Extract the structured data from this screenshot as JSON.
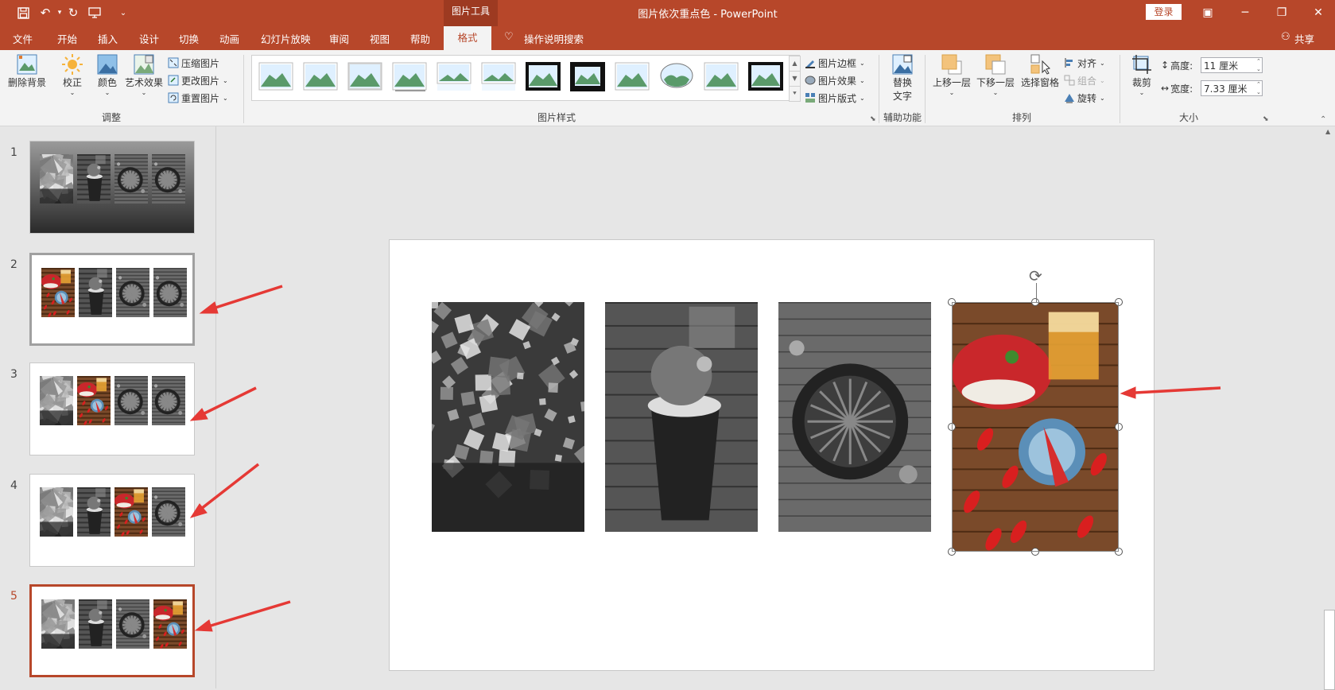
{
  "titlebar": {
    "doc_title": "图片依次重点色 - PowerPoint",
    "context_tools": "图片工具",
    "login": "登录",
    "share": "共享"
  },
  "tabs": [
    "文件",
    "开始",
    "插入",
    "设计",
    "切换",
    "动画",
    "幻灯片放映",
    "审阅",
    "视图",
    "帮助",
    "格式"
  ],
  "active_tab": "格式",
  "tell_me": "操作说明搜索",
  "ribbon": {
    "adjust": {
      "remove_bg": "删除背景",
      "correct": "校正",
      "color": "颜色",
      "artistic": "艺术效果",
      "compress": "压缩图片",
      "change": "更改图片",
      "reset": "重置图片",
      "label": "调整"
    },
    "styles": {
      "label": "图片样式",
      "border": "图片边框",
      "effects": "图片效果",
      "layout": "图片版式"
    },
    "accessibility": {
      "alt_text_line1": "替换",
      "alt_text_line2": "文字",
      "label": "辅助功能"
    },
    "arrange": {
      "bring_forward": "上移一层",
      "send_backward": "下移一层",
      "selection_pane": "选择窗格",
      "align": "对齐",
      "group": "组合",
      "rotate": "旋转",
      "label": "排列"
    },
    "size": {
      "crop": "裁剪",
      "height_label": "高度:",
      "height_value": "11 厘米",
      "width_label": "宽度:",
      "width_value": "7.33 厘米",
      "label": "大小"
    }
  },
  "slides": [
    "1",
    "2",
    "3",
    "4",
    "5"
  ],
  "selected_slide": "5",
  "colors": {
    "accent": "#b7472a",
    "context_tab": "#9d3a21",
    "arrow": "#e53935"
  }
}
